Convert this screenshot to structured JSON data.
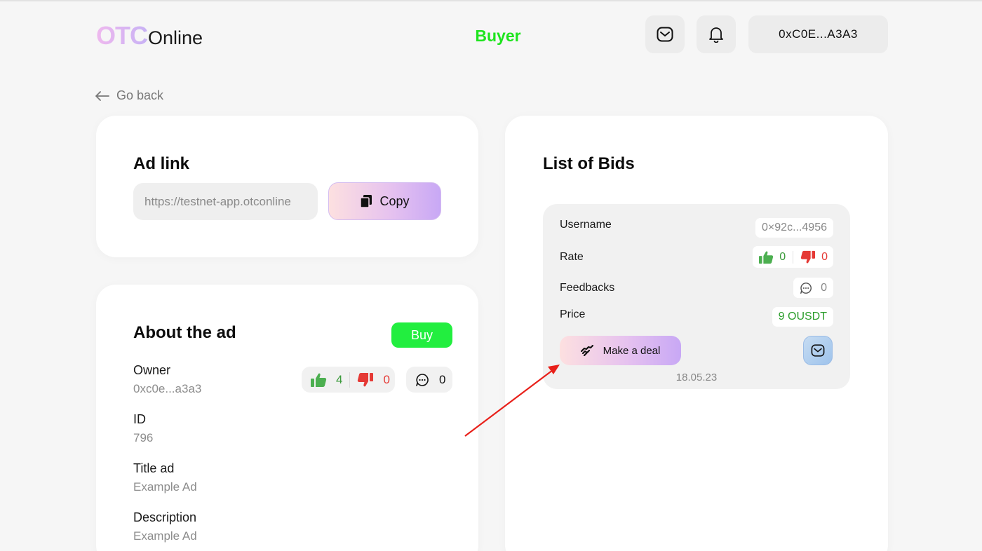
{
  "header": {
    "logo_part1": "OTC",
    "logo_part2": "Online",
    "role": "Buyer",
    "wallet": "0xC0E...A3A3"
  },
  "nav": {
    "go_back": "Go back"
  },
  "ad_link": {
    "title": "Ad link",
    "url": "https://testnet-app.otconline",
    "copy_label": "Copy"
  },
  "about": {
    "title": "About the ad",
    "buy_label": "Buy",
    "likes": "4",
    "dislikes": "0",
    "comments": "0",
    "fields": [
      {
        "label": "Owner",
        "value": "0xc0e...a3a3"
      },
      {
        "label": "ID",
        "value": "796"
      },
      {
        "label": "Title ad",
        "value": "Example Ad"
      },
      {
        "label": "Description",
        "value": "Example Ad"
      }
    ]
  },
  "bids": {
    "title": "List of Bids",
    "items": [
      {
        "username_label": "Username",
        "username": "0×92c...4956",
        "rate_label": "Rate",
        "likes": "0",
        "dislikes": "0",
        "feedbacks_label": "Feedbacks",
        "feedbacks": "0",
        "price_label": "Price",
        "price": "9 OUSDT",
        "deal_label": "Make a deal",
        "date": "18.05.23"
      }
    ]
  },
  "colors": {
    "buyer_green": "#1ee41e",
    "buy_button": "#22ee3f",
    "like_green": "#4caf50",
    "dislike_red": "#e53935",
    "price_green": "#2a9d2a",
    "arrow_red": "#e8201a"
  }
}
